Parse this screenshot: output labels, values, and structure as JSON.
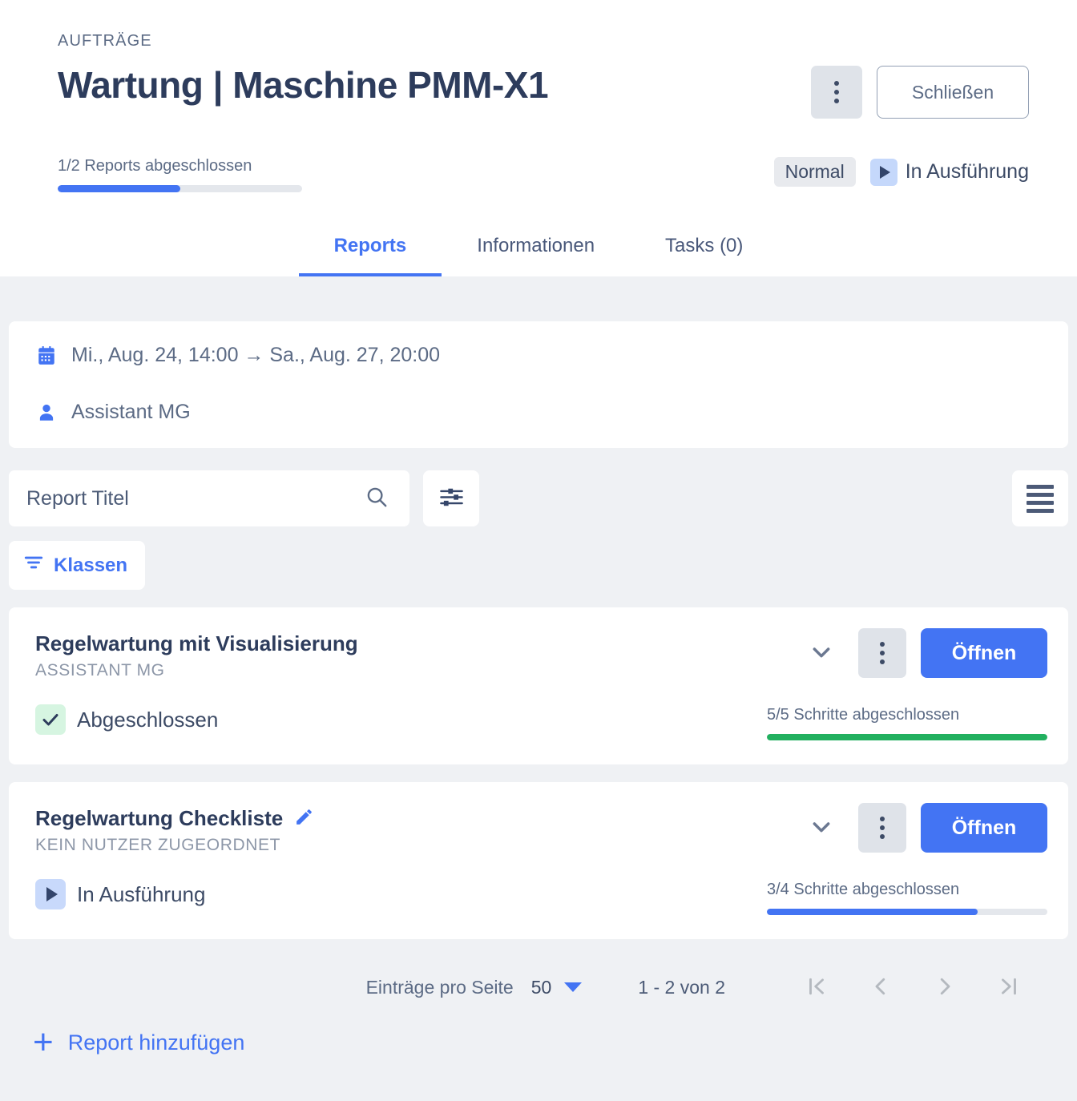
{
  "header": {
    "eyebrow": "AUFTRÄGE",
    "title": "Wartung | Maschine PMM-X1",
    "kebab_icon": "more-vertical-icon",
    "close_label": "Schließen",
    "progress_label": "1/2 Reports abgeschlossen",
    "progress_percent": 50,
    "priority_badge": "Normal",
    "state_label": "In Ausführung",
    "state_icon": "play-icon"
  },
  "tabs": [
    {
      "label": "Reports",
      "active": true
    },
    {
      "label": "Informationen",
      "active": false
    },
    {
      "label": "Tasks (0)",
      "active": false
    }
  ],
  "info_card": {
    "date_range": "Mi., Aug. 24, 14:00 → Sa., Aug. 27, 20:00",
    "date_icon": "calendar-icon",
    "assignee": "Assistant MG",
    "assignee_icon": "person-icon"
  },
  "toolbar": {
    "search_placeholder": "Report Titel",
    "search_value": "",
    "search_icon": "search-icon",
    "tune_icon": "sliders-icon",
    "list_icon": "list-view-icon",
    "klassen_label": "Klassen",
    "klassen_icon": "filter-icon"
  },
  "reports": [
    {
      "title": "Regelwartung mit Visualisierung",
      "subtitle": "ASSISTANT MG",
      "has_edit_icon": false,
      "status_label": "Abgeschlossen",
      "status_icon": "check-icon",
      "steps_label": "5/5 Schritte abgeschlossen",
      "steps_percent": 100,
      "steps_color": "#22b05f",
      "expand_icon": "chevron-down-icon",
      "kebab_icon": "more-vertical-icon",
      "open_label": "Öffnen"
    },
    {
      "title": "Regelwartung Checkliste",
      "subtitle": "KEIN NUTZER ZUGEORDNET",
      "has_edit_icon": true,
      "edit_icon": "pencil-icon",
      "status_label": "In Ausführung",
      "status_icon": "play-icon",
      "steps_label": "3/4 Schritte abgeschlossen",
      "steps_percent": 75,
      "steps_color": "#4374f3",
      "expand_icon": "chevron-down-icon",
      "kebab_icon": "more-vertical-icon",
      "open_label": "Öffnen"
    }
  ],
  "pagination": {
    "per_page_label": "Einträge pro Seite",
    "per_page_value": "50",
    "range_label": "1 - 2 von 2",
    "first_icon": "first-page-icon",
    "prev_icon": "previous-page-icon",
    "next_icon": "next-page-icon",
    "last_icon": "last-page-icon"
  },
  "footer": {
    "add_label": "Report hinzufügen",
    "add_icon": "plus-icon"
  },
  "colors": {
    "accent": "#4374f3",
    "success": "#22b05f",
    "text": "#3d4b66",
    "muted": "#8d97a8",
    "page_bg": "#eff1f4"
  }
}
